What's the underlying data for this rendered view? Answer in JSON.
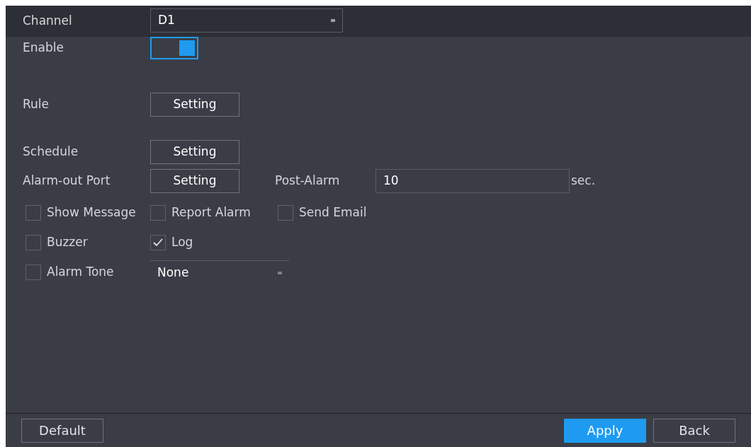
{
  "channel": {
    "label": "Channel",
    "value": "D1"
  },
  "enable": {
    "label": "Enable",
    "on": true
  },
  "rule": {
    "label": "Rule",
    "button": "Setting"
  },
  "schedule": {
    "label": "Schedule",
    "button": "Setting"
  },
  "alarm_out_port": {
    "label": "Alarm-out Port",
    "button": "Setting"
  },
  "post_alarm": {
    "label": "Post-Alarm",
    "value": "10",
    "unit": "sec."
  },
  "checkbox_rows": [
    [
      {
        "label": "Show Message",
        "checked": false
      },
      {
        "label": "Report Alarm",
        "checked": false
      },
      {
        "label": "Send Email",
        "checked": false
      }
    ],
    [
      {
        "label": "Buzzer",
        "checked": false
      },
      {
        "label": "Log",
        "checked": true
      }
    ]
  ],
  "alarm_tone": {
    "label": "Alarm Tone",
    "checked": false,
    "value": "None"
  },
  "footer_buttons": [
    {
      "label": "Default",
      "kind": "secondary"
    },
    {
      "label": "Apply",
      "kind": "primary"
    },
    {
      "label": "Back",
      "kind": "secondary"
    }
  ]
}
